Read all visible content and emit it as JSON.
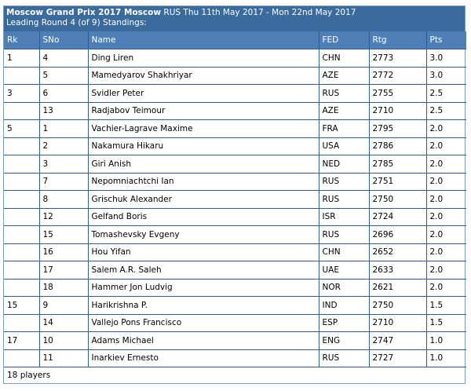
{
  "header": {
    "title_bold": "Moscow Grand Prix 2017 Moscow",
    "title_rest": " RUS Thu 11th May 2017 - Mon 22nd May 2017",
    "subtitle": "Leading Round 4 (of 9) Standings:"
  },
  "columns": [
    "Rk",
    "SNo",
    "Name",
    "FED",
    "Rtg",
    "Pts"
  ],
  "rows": [
    {
      "rk": "1",
      "sno": "4",
      "name": "Ding Liren",
      "fed": "CHN",
      "rtg": "2773",
      "pts": "3.0"
    },
    {
      "rk": "",
      "sno": "5",
      "name": "Mamedyarov Shakhriyar",
      "fed": "AZE",
      "rtg": "2772",
      "pts": "3.0"
    },
    {
      "rk": "3",
      "sno": "6",
      "name": "Svidler Peter",
      "fed": "RUS",
      "rtg": "2755",
      "pts": "2.5"
    },
    {
      "rk": "",
      "sno": "13",
      "name": "Radjabov Teimour",
      "fed": "AZE",
      "rtg": "2710",
      "pts": "2.5"
    },
    {
      "rk": "5",
      "sno": "1",
      "name": "Vachier-Lagrave Maxime",
      "fed": "FRA",
      "rtg": "2795",
      "pts": "2.0"
    },
    {
      "rk": "",
      "sno": "2",
      "name": "Nakamura Hikaru",
      "fed": "USA",
      "rtg": "2786",
      "pts": "2.0"
    },
    {
      "rk": "",
      "sno": "3",
      "name": "Giri Anish",
      "fed": "NED",
      "rtg": "2785",
      "pts": "2.0"
    },
    {
      "rk": "",
      "sno": "7",
      "name": "Nepomniachtchi Ian",
      "fed": "RUS",
      "rtg": "2751",
      "pts": "2.0"
    },
    {
      "rk": "",
      "sno": "8",
      "name": "Grischuk Alexander",
      "fed": "RUS",
      "rtg": "2750",
      "pts": "2.0"
    },
    {
      "rk": "",
      "sno": "12",
      "name": "Gelfand Boris",
      "fed": "ISR",
      "rtg": "2724",
      "pts": "2.0"
    },
    {
      "rk": "",
      "sno": "15",
      "name": "Tomashevsky Evgeny",
      "fed": "RUS",
      "rtg": "2696",
      "pts": "2.0"
    },
    {
      "rk": "",
      "sno": "16",
      "name": "Hou Yifan",
      "fed": "CHN",
      "rtg": "2652",
      "pts": "2.0"
    },
    {
      "rk": "",
      "sno": "17",
      "name": "Salem A.R. Saleh",
      "fed": "UAE",
      "rtg": "2633",
      "pts": "2.0"
    },
    {
      "rk": "",
      "sno": "18",
      "name": "Hammer Jon Ludvig",
      "fed": "NOR",
      "rtg": "2621",
      "pts": "2.0"
    },
    {
      "rk": "15",
      "sno": "9",
      "name": "Harikrishna P.",
      "fed": "IND",
      "rtg": "2750",
      "pts": "1.5"
    },
    {
      "rk": "",
      "sno": "14",
      "name": "Vallejo Pons Francisco",
      "fed": "ESP",
      "rtg": "2710",
      "pts": "1.5"
    },
    {
      "rk": "17",
      "sno": "10",
      "name": "Adams Michael",
      "fed": "ENG",
      "rtg": "2747",
      "pts": "1.0"
    },
    {
      "rk": "",
      "sno": "11",
      "name": "Inarkiev Ernesto",
      "fed": "RUS",
      "rtg": "2727",
      "pts": "1.0"
    }
  ],
  "footer": {
    "players_text": "18 players"
  }
}
